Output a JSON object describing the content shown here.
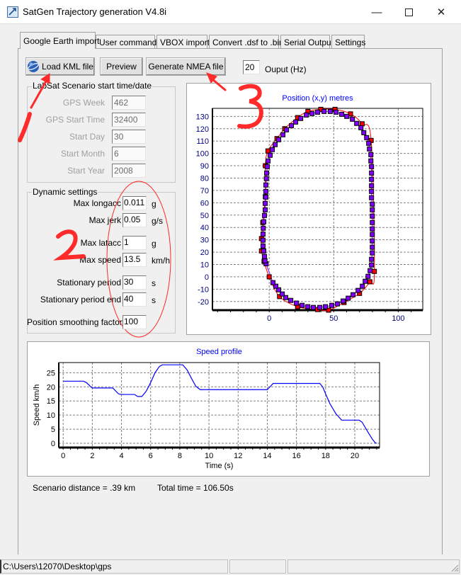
{
  "window": {
    "title": "SatGen Trajectory generation V4.8i",
    "controls": [
      "minimize-icon",
      "maximize-icon",
      "close-icon"
    ]
  },
  "tabs": [
    {
      "label": "Google Earth import",
      "active": true
    },
    {
      "label": "User commands"
    },
    {
      "label": "VBOX import"
    },
    {
      "label": "Convert .dsf to .bin"
    },
    {
      "label": "Serial Output"
    },
    {
      "label": "Settings"
    }
  ],
  "toolbar": {
    "load_kml": "Load KML file",
    "preview": "Preview",
    "generate_nmea": "Generate NMEA file",
    "output_value": "20",
    "output_label": "Ouput (Hz)"
  },
  "start_group": {
    "title": "LabSat Scenario start time/date",
    "fields": [
      {
        "label": "GPS Week",
        "value": "462"
      },
      {
        "label": "GPS Start Time",
        "value": "32400"
      },
      {
        "label": "Start Day",
        "value": "30"
      },
      {
        "label": "Start Month",
        "value": "6"
      },
      {
        "label": "Start Year",
        "value": "2008"
      }
    ]
  },
  "dynamic_group": {
    "title": "Dynamic settings",
    "fields": [
      {
        "label": "Max longacc",
        "value": "0.011",
        "unit": "g"
      },
      {
        "label": "Max jerk",
        "value": "0.05",
        "unit": "g/s"
      },
      {
        "label": "Max latacc",
        "value": "1",
        "unit": "g"
      },
      {
        "label": "Max speed",
        "value": "13.5",
        "unit": "km/h"
      },
      {
        "label": "Stationary period",
        "value": "30",
        "unit": "s"
      },
      {
        "label": "Stationary period end",
        "value": "40",
        "unit": "s"
      },
      {
        "label": "Position smoothing factor",
        "value": "100",
        "unit": ""
      }
    ]
  },
  "footer": {
    "distance": "Scenario distance = .39 km",
    "total_time": "Total time = 106.50s"
  },
  "statusbar": {
    "path": "C:\\Users\\12070\\Desktop\\gps"
  },
  "annotation_color": "#ff2020",
  "chart_data": [
    {
      "type": "scatter",
      "title": "Position (x,y) metres",
      "xlabel": "",
      "ylabel": "",
      "xlim": [
        -44,
        119
      ],
      "ylim": [
        -27,
        136.5
      ],
      "xticks": [
        0,
        50,
        100
      ],
      "yticks": [
        -20,
        -10,
        0,
        10,
        20,
        30,
        40,
        50,
        60,
        70,
        80,
        90,
        100,
        110,
        120,
        130
      ],
      "grid": true,
      "series": [
        {
          "color": "#ff0000",
          "marker": "square",
          "line": "smooth-closed",
          "x": [
            -6,
            -6,
            -5,
            -3,
            -3,
            -1,
            6,
            12,
            22,
            30,
            40,
            51,
            63,
            72,
            79,
            81.5,
            78,
            70,
            58,
            46,
            37.5,
            22,
            8,
            0,
            -4
          ],
          "y": [
            21,
            31,
            44,
            65,
            90,
            102,
            112,
            120,
            129,
            134,
            135.7,
            135.7,
            132,
            124,
            110.5,
            4.4,
            -4,
            -13.4,
            -20.8,
            -27,
            -26.5,
            -24.2,
            -16,
            0,
            12.5
          ]
        },
        {
          "color": "#8000ff",
          "marker": "square",
          "line": "straight",
          "x": [
            -2.4,
            -3.3,
            -3.7,
            -4.2,
            -4.8,
            -4.8,
            -4.8,
            -4.6,
            -4.2,
            -3.7,
            -3.1,
            -3.1,
            -2.6,
            -2.6,
            -2.6,
            -2.2,
            -2.0,
            -1.5,
            -0.9,
            0.7,
            2.4,
            4.6,
            7.3,
            10.6,
            13.4,
            17.2,
            20.5,
            24.4,
            28.8,
            33.2,
            37.5,
            42.5,
            47.3,
            51.8,
            56.2,
            60.1,
            64.5,
            67.8,
            71.1,
            73.3,
            75.5,
            77.1,
            77.7,
            78.8,
            78.8,
            79.3,
            79.3,
            79.3,
            79.3,
            79.3,
            79.3,
            79.9,
            79.9,
            79.9,
            79.9,
            79.9,
            79.9,
            79.9,
            79.9,
            79.9,
            79.3,
            79.3,
            78.2,
            76.6,
            74.4,
            72.2,
            68.9,
            65.0,
            61.2,
            57.3,
            52.9,
            48.5,
            43.6,
            39.2,
            34.2,
            29.9,
            25.5,
            21.1,
            16.7,
            12.8,
            10.1,
            7.3,
            5.1,
            2.9
          ],
          "y": [
            10.6,
            13,
            16.5,
            21,
            25,
            29.7,
            34.6,
            39.4,
            44.6,
            49.7,
            54.3,
            59.5,
            64.6,
            69.2,
            74.4,
            79.6,
            84.1,
            89.3,
            93.9,
            98.5,
            103.1,
            107.1,
            111.1,
            115.1,
            119.1,
            122.5,
            125.4,
            128.3,
            131.1,
            132.3,
            133.4,
            134,
            134,
            133.4,
            131.7,
            130,
            127.7,
            124.3,
            120.8,
            116.8,
            112.8,
            108.2,
            103.6,
            99,
            93.9,
            89.3,
            84.1,
            79,
            73.8,
            69.2,
            64.1,
            58.9,
            54.3,
            49.2,
            44,
            38.8,
            34.3,
            29.1,
            24,
            19.4,
            14.2,
            9.6,
            5,
            0.4,
            -3.6,
            -7.6,
            -11,
            -14.5,
            -17.3,
            -19.6,
            -21.9,
            -23.1,
            -24.2,
            -24.8,
            -24.8,
            -24.2,
            -23.1,
            -21.3,
            -19.1,
            -16.8,
            -13.9,
            -10.5,
            -7.6,
            -4.7
          ]
        }
      ]
    },
    {
      "type": "line",
      "title": "Speed profile",
      "xlabel": "Time (s)",
      "ylabel": "Speed km/h",
      "xlim": [
        -0.3,
        21.7
      ],
      "ylim": [
        -1.5,
        28.6
      ],
      "xticks": [
        0,
        2,
        4,
        6,
        8,
        10,
        12,
        14,
        16,
        18,
        20
      ],
      "yticks": [
        0,
        5,
        10,
        15,
        20,
        25
      ],
      "grid": true,
      "series": [
        {
          "color": "#0000ff",
          "x": [
            0,
            1.4,
            1.6,
            1.9,
            2.0,
            3.4,
            3.8,
            4.0,
            4.9,
            5.1,
            5.4,
            5.7,
            6.0,
            6.3,
            6.6,
            6.8,
            8.2,
            8.5,
            8.8,
            9.1,
            9.4,
            14.0,
            14.4,
            17.6,
            17.8,
            18.0,
            18.3,
            18.7,
            19.1,
            20.3,
            20.5,
            20.9,
            21.2,
            21.4,
            21.5
          ],
          "y": [
            22,
            22,
            21.5,
            20,
            19.6,
            19.6,
            17.5,
            17.3,
            17.3,
            16.6,
            16.6,
            18.5,
            21.5,
            25,
            27.2,
            27.8,
            27.8,
            26,
            23,
            20.2,
            19,
            19,
            21.2,
            21.2,
            20,
            17.5,
            14,
            10.5,
            8.2,
            8.2,
            7.5,
            4,
            1.5,
            0.2,
            0
          ]
        }
      ]
    }
  ]
}
